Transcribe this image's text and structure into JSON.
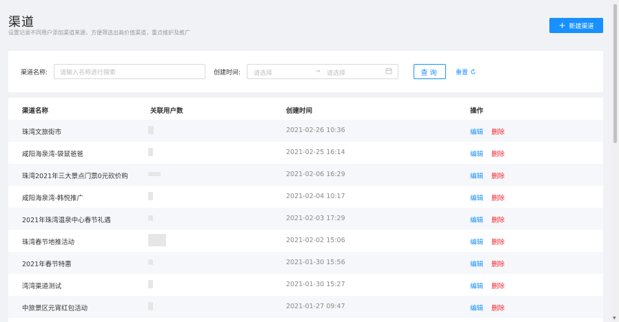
{
  "header": {
    "title": "渠道",
    "description": "设置记录不同用户添加渠道来源，方便筛选出高价值渠道，重点维护及推广",
    "new_button_icon": "plus-icon",
    "new_button_label": "新建渠道"
  },
  "filters": {
    "name_label": "渠道名称:",
    "name_placeholder": "请输入名称进行搜索",
    "time_label": "创建时间:",
    "start_placeholder": "请选择",
    "range_separator": "→",
    "end_placeholder": "请选择",
    "calendar_icon": "calendar-icon",
    "query_label": "查询",
    "reset_label": "重置"
  },
  "table": {
    "columns": [
      "渠道名称",
      "关联用户数",
      "创建时间",
      "操作"
    ],
    "edit_label": "编辑",
    "delete_label": "删除",
    "rows": [
      {
        "name": "珠湾文旅街市",
        "created": "2021-02-26 10:36"
      },
      {
        "name": "咸阳海泉湾-袋鼠爸爸",
        "created": "2021-02-25 16:14"
      },
      {
        "name": "珠湾2021年三大景点门票0元砍价购",
        "created": "2021-02-06 16:29"
      },
      {
        "name": "咸阳海泉湾-韩悦推广",
        "created": "2021-02-04 10:17"
      },
      {
        "name": "2021年珠湾温泉中心春节礼遇",
        "created": "2021-02-03 17:29"
      },
      {
        "name": "珠湾春节地推活动",
        "created": "2021-02-02 15:06"
      },
      {
        "name": "2021年春节特惠",
        "created": "2021-01-30 15:56"
      },
      {
        "name": "湾湾渠道测试",
        "created": "2021-01-30 15:27"
      },
      {
        "name": "中旅景区元宵红包活动",
        "created": "2021-01-27 09:47"
      }
    ]
  }
}
